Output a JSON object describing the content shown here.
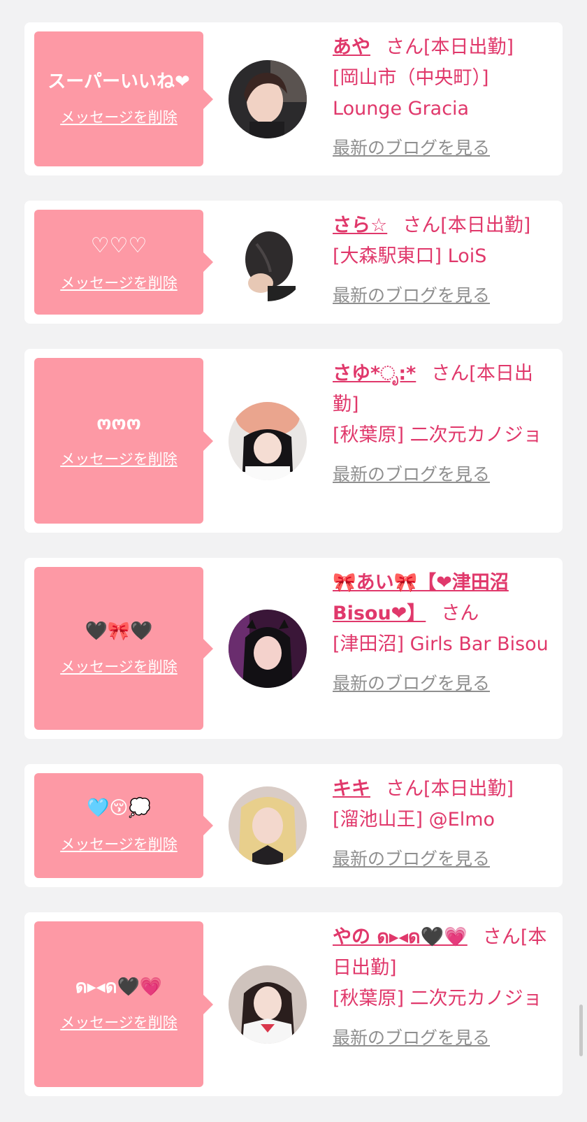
{
  "colors": {
    "background": "#f2f2f3",
    "card": "#ffffff",
    "bubble": "#fd99a5",
    "accent_pink": "#e0386b",
    "link_gray": "#8f8f8f"
  },
  "common": {
    "delete_label": "メッセージを削除",
    "blog_label": "最新のブログを見る",
    "san": "さん"
  },
  "items": [
    {
      "message": "スーパーいいね❤",
      "name": "あや",
      "status": "[本日出勤]",
      "store": "[岡山市（中央町）] Lounge Gracia",
      "avatar_icon": "avatar-photo"
    },
    {
      "message": "♡♡♡",
      "name": "さら☆",
      "status": "[本日出勤]",
      "store": "[大森駅東口] LoiS",
      "avatar_icon": "avatar-photo"
    },
    {
      "message": "ოოო",
      "name": "さゆ*ೃ:*",
      "status": "[本日出勤]",
      "store": "[秋葉原] 二次元カノジョ",
      "avatar_icon": "avatar-photo"
    },
    {
      "message": "🖤🎀🖤",
      "name": "🎀あい🎀【❤津田沼Bisou❤】",
      "status": "",
      "store": "[津田沼] Girls Bar Bisou",
      "avatar_icon": "avatar-photo"
    },
    {
      "message": "🩵😚💭",
      "name": "キキ",
      "status": "[本日出勤]",
      "store": "[溜池山王] @Elmo",
      "avatar_icon": "avatar-photo"
    },
    {
      "message": "ด▸◂ด🖤💗",
      "name": "やの ด▸◂ด🖤💗",
      "status": "[本日出勤]",
      "store": "[秋葉原] 二次元カノジョ",
      "avatar_icon": "avatar-photo"
    }
  ]
}
